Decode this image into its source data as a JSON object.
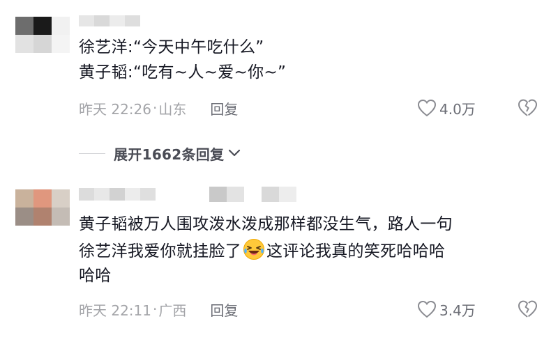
{
  "comments": [
    {
      "line1": "徐艺洋:“今天中午吃什么”",
      "line2": "黄子韬:“吃有~人~爱~你~”",
      "time": "昨天 22:26",
      "location": "山东",
      "reply_label": "回复",
      "likes": "4.0万"
    },
    {
      "line1": "黄子韬被万人围攻泼水泼成那样都没生气，路人一句",
      "line2_before": "徐艺洋我爱你就挂脸了",
      "line2_after": "这评论我真的笑死哈哈哈",
      "line3": "哈哈",
      "emoji": "laughing-crying-emoji",
      "time": "昨天 22:11",
      "location": "广西",
      "reply_label": "回复",
      "likes": "3.4万"
    }
  ],
  "expand_replies": {
    "label": "展开1662条回复"
  },
  "separator": "·",
  "colors": {
    "text_primary": "#161823",
    "text_meta": "#a3a4a8",
    "text_action": "#6b6d75",
    "divider": "#d4d5d8"
  },
  "icons": {
    "like": "heart-outline-icon",
    "dislike": "broken-heart-icon",
    "expand": "chevron-down-icon"
  }
}
